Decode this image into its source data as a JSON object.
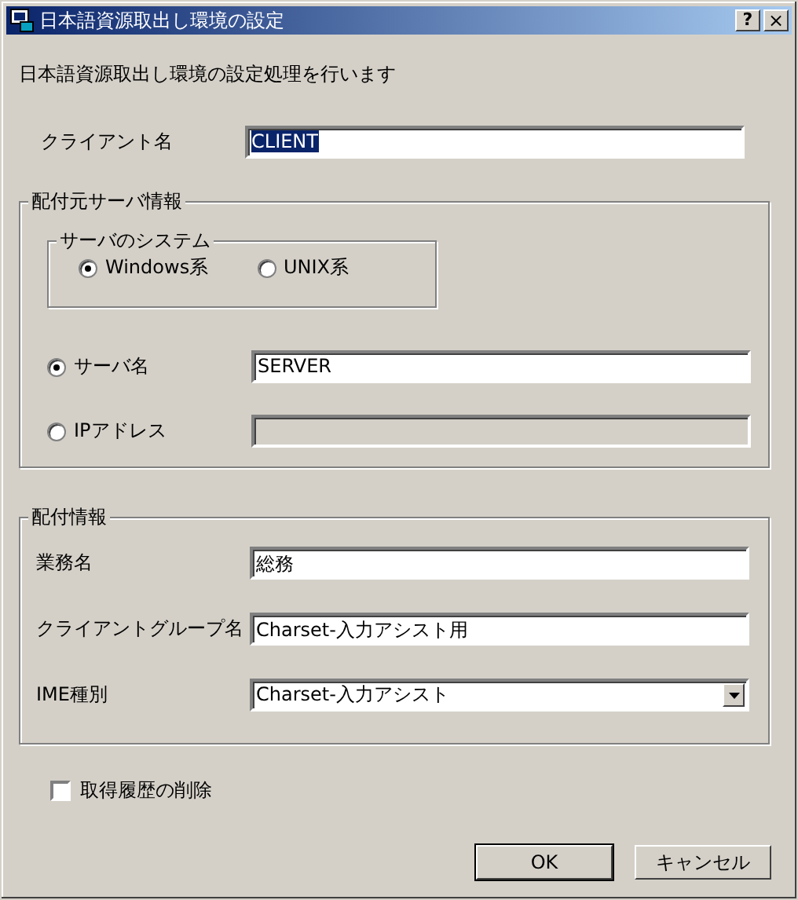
{
  "window": {
    "title": "日本語資源取出し環境の設定",
    "buttons": [
      {
        "kind": "help",
        "label": "?"
      },
      {
        "kind": "close",
        "label": "×"
      }
    ]
  },
  "description": "日本語資源取出し環境の設定処理を行います",
  "client": {
    "label": "クライアント名",
    "value": "CLIENT",
    "highlighted": true
  },
  "server_info": {
    "title": "配付元サーバ情報",
    "system": {
      "title": "サーバのシステム",
      "options": [
        {
          "label": "Windows系",
          "selected": true
        },
        {
          "label": "UNIX系",
          "selected": false
        }
      ]
    },
    "sources": [
      {
        "label": "サーバ名",
        "selected": true,
        "value": "SERVER",
        "disabled": false
      },
      {
        "label": "IPアドレス",
        "selected": false,
        "disabled": true
      }
    ]
  },
  "distribution": {
    "title": "配付情報",
    "fields": [
      {
        "kind": "text",
        "label": "業務名",
        "value": "総務"
      },
      {
        "kind": "text",
        "label": "クライアントグループ名",
        "value": "Charset-入力アシスト用"
      },
      {
        "kind": "dropdown",
        "label": "IME種別",
        "value": "Charset-入力アシスト"
      }
    ]
  },
  "history_delete": {
    "label": "取得履歴の削除",
    "checked": false
  },
  "buttons": [
    {
      "label": "OK",
      "default": true
    },
    {
      "label": "キャンセル",
      "default": false
    }
  ]
}
